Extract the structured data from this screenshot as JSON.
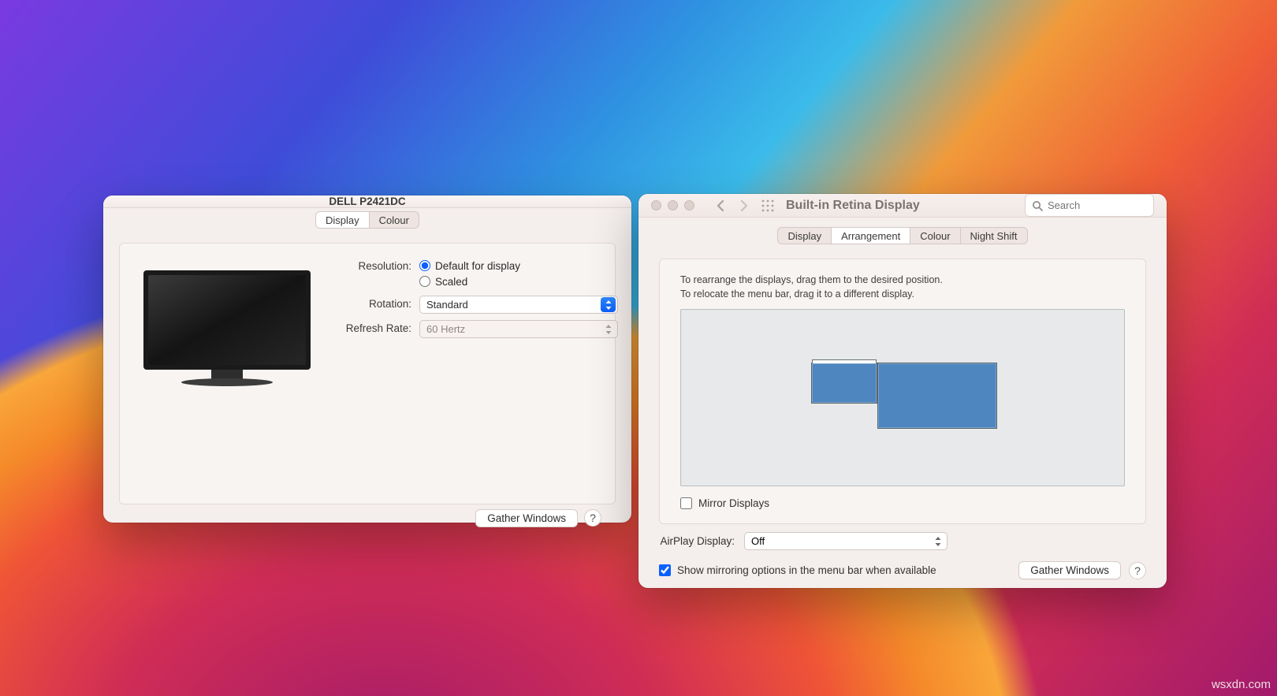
{
  "watermark": "wsxdn.com",
  "window1": {
    "title": "DELL P2421DC",
    "tabs": {
      "display": "Display",
      "colour": "Colour"
    },
    "labels": {
      "resolution": "Resolution:",
      "rotation": "Rotation:",
      "refresh": "Refresh Rate:",
      "default_for_display": "Default for display",
      "scaled": "Scaled"
    },
    "rotation_value": "Standard",
    "refresh_value": "60 Hertz",
    "gather": "Gather Windows",
    "help": "?"
  },
  "window2": {
    "title": "Built-in Retina Display",
    "search_placeholder": "Search",
    "tabs": {
      "display": "Display",
      "arrangement": "Arrangement",
      "colour": "Colour",
      "nightshift": "Night Shift"
    },
    "hint1": "To rearrange the displays, drag them to the desired position.",
    "hint2": "To relocate the menu bar, drag it to a different display.",
    "mirror": "Mirror Displays",
    "airplay_label": "AirPlay Display:",
    "airplay_value": "Off",
    "show_mirroring": "Show mirroring options in the menu bar when available",
    "gather": "Gather Windows",
    "help": "?"
  }
}
